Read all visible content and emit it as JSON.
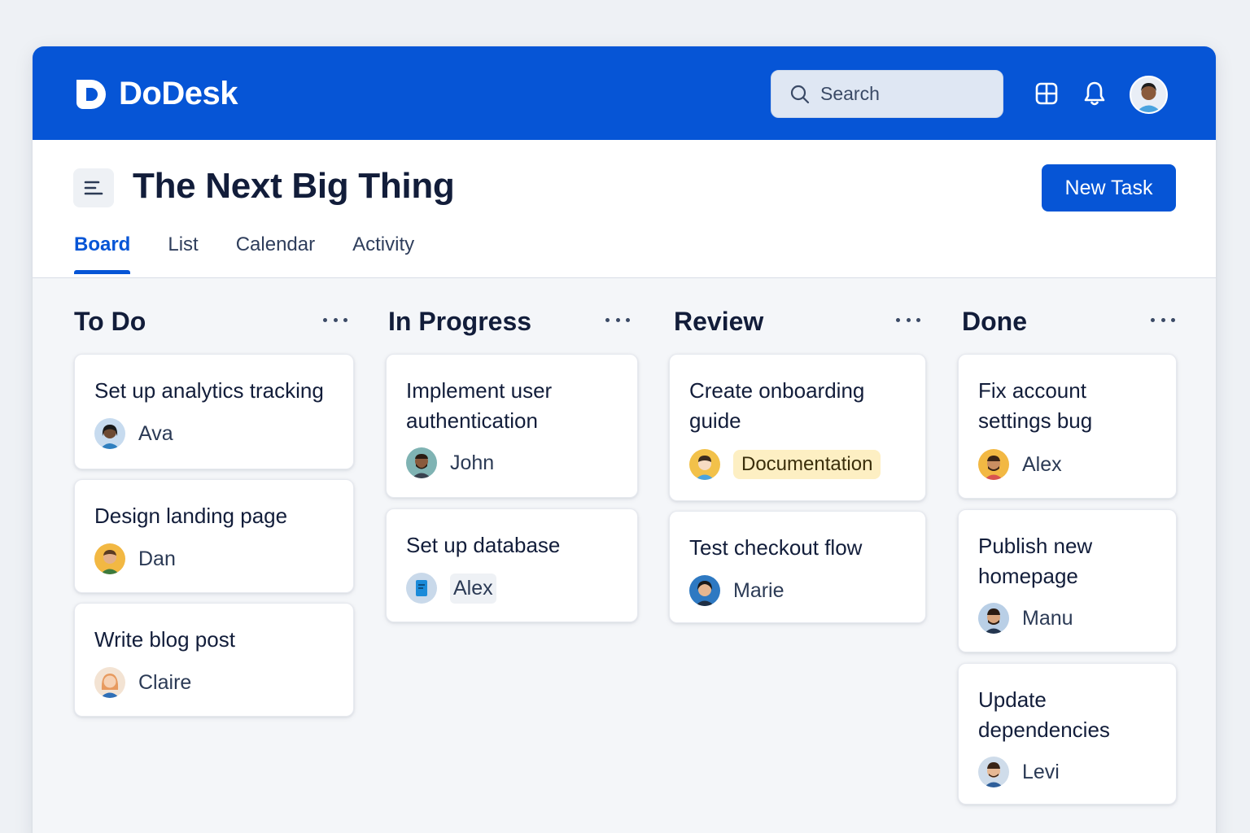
{
  "app": {
    "name": "DoDesk"
  },
  "search": {
    "placeholder": "Search"
  },
  "header": {
    "title": "The Next Big Thing",
    "new_task_label": "New Task",
    "tabs": [
      {
        "label": "Board",
        "active": true
      },
      {
        "label": "List",
        "active": false
      },
      {
        "label": "Calendar",
        "active": false
      },
      {
        "label": "Activity",
        "active": false
      }
    ]
  },
  "colors": {
    "brand": "#0655d6",
    "tag_documentation": "#fdefc3",
    "background": "#f4f6f9"
  },
  "columns": [
    {
      "title": "To Do",
      "cards": [
        {
          "title": "Set up analytics tracking",
          "assignee": "Ava",
          "avatar": "avatar-ava-icon"
        },
        {
          "title": "Design landing page",
          "assignee": "Dan",
          "avatar": "avatar-dan-icon"
        },
        {
          "title": "Write blog post",
          "assignee": "Claire",
          "avatar": "avatar-claire-icon"
        }
      ]
    },
    {
      "title": "In Progress",
      "cards": [
        {
          "title": "Implement user authentication",
          "assignee": "John",
          "avatar": "avatar-john-icon"
        },
        {
          "title": "Set up database",
          "assignee": "Alex",
          "avatar": "document-icon"
        }
      ]
    },
    {
      "title": "Review",
      "cards": [
        {
          "title": "Create onboarding guide",
          "tag": "Documentation",
          "avatar": "avatar-reviewer-icon"
        },
        {
          "title": "Test checkout flow",
          "assignee": "Marie",
          "avatar": "avatar-marie-icon"
        }
      ]
    },
    {
      "title": "Done",
      "cards": [
        {
          "title": "Fix account settings bug",
          "assignee": "Alex",
          "avatar": "avatar-alex-icon"
        },
        {
          "title": "Publish new homepage",
          "assignee": "Manu",
          "avatar": "avatar-manu-icon"
        },
        {
          "title": "Update dependencies",
          "assignee": "Levi",
          "avatar": "avatar-levi-icon"
        }
      ]
    }
  ]
}
